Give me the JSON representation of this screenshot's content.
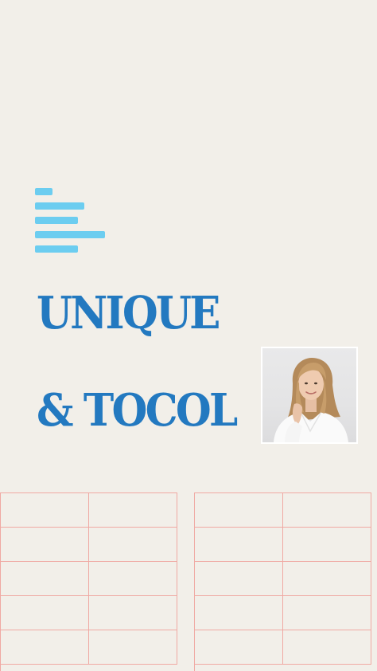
{
  "colors": {
    "background": "#f2efe9",
    "bars": "#6ccdf0",
    "title": "#2379c0",
    "grid_lines": "#f0a9a3"
  },
  "icon": "bar-chart-lines-icon",
  "title": {
    "line1": "UNIQUE",
    "line2": "& TOCOL"
  },
  "photo": {
    "icon": "portrait-photo"
  },
  "grid": {
    "rows": 5,
    "columns_per_panel": 2,
    "panels": 2
  }
}
